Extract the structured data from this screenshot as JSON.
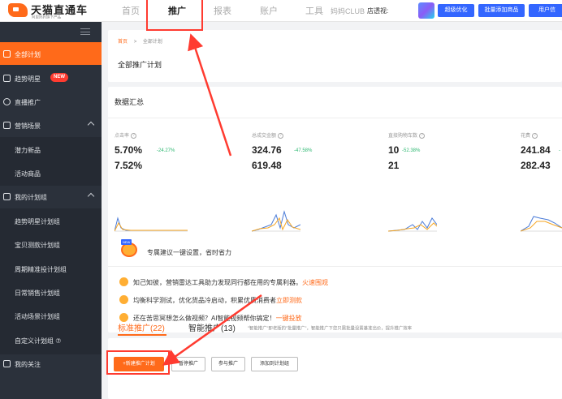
{
  "brand": {
    "title": "天猫直通车",
    "subtitle": "阿里妈妈旗下产品"
  },
  "nav": [
    {
      "label": "首页"
    },
    {
      "label": "推广"
    },
    {
      "label": "报表"
    },
    {
      "label": "账户"
    },
    {
      "label": "工具"
    },
    {
      "label": "妈妈CLUB"
    }
  ],
  "header": {
    "shop_view": "店透视:",
    "buttons": [
      "超级优化",
      "批量添加商品",
      "用户信"
    ]
  },
  "sidebar": {
    "items": [
      {
        "label": "全部计划"
      },
      {
        "label": "趋势明星",
        "badge": "NEW"
      },
      {
        "label": "直播推广"
      },
      {
        "label": "营销场景"
      },
      {
        "label": "潜力新品"
      },
      {
        "label": "活动商品"
      },
      {
        "label": "我的计划组"
      },
      {
        "label": "趋势明星计划组"
      },
      {
        "label": "宝贝测款计划组"
      },
      {
        "label": "周期精准投计划组"
      },
      {
        "label": "日常销售计划组"
      },
      {
        "label": "活动场景计划组"
      },
      {
        "label": "自定义计划组 ⑦"
      },
      {
        "label": "我的关注"
      }
    ]
  },
  "breadcrumb": {
    "home": "首页",
    "sep": ">",
    "current": "全部计划"
  },
  "page_title": "全部推广计划",
  "summary": {
    "title": "数据汇总",
    "metrics": [
      {
        "label": "点击率",
        "value": "5.70%",
        "change": "-24.27%",
        "prev": "7.52%"
      },
      {
        "label": "总成交金额",
        "value": "324.76",
        "change": "-47.58%",
        "prev": "619.48"
      },
      {
        "label": "直接购物车数",
        "value": "10",
        "change": "-52.38%",
        "prev": "21"
      },
      {
        "label": "花费",
        "value": "241.84",
        "change": "-",
        "prev": "282.43"
      }
    ]
  },
  "tips": {
    "header": "专属建议一键设置，省时省力",
    "mascot_badge": "NEW",
    "rows": [
      {
        "text": "知己知彼，营销雷达工具助力发现同行都在用的专属利器。",
        "link": "火速围观"
      },
      {
        "text": "均衡科学测试，优化货品冷启动，积累优质消费者",
        "link": "立即测款"
      },
      {
        "text": "还在苦思冥想怎么做视频？AI智能视频帮你搞定！",
        "link": "一键投放"
      }
    ]
  },
  "tabs": [
    {
      "label": "标准推广(22)"
    },
    {
      "label": "智能推广(13)"
    }
  ],
  "tab_desc": "\"智能推广\"即老版的\"批量推广\"，智能推广下您只需批量设置基准出价，提升推广效率",
  "actions": [
    "+新建推广计划",
    "暂停推广",
    "参与推广",
    "添加到计划组"
  ],
  "colors": {
    "accent": "#ff6a1a",
    "sidebar_bg": "#2b313b",
    "positive": "#2eb872",
    "annotation": "#ff3b30",
    "brand_blue": "#3366ff"
  }
}
